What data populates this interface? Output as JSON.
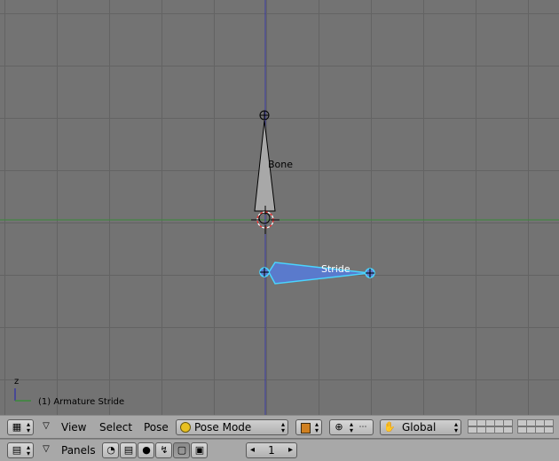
{
  "viewport": {
    "bone1_label": "Bone",
    "bone2_label": "Stride",
    "status_text": "(1) Armature Stride",
    "axis_z": "z"
  },
  "header1": {
    "menus": [
      "View",
      "Select",
      "Pose"
    ],
    "mode_value": "Pose Mode",
    "orientation_value": "Global"
  },
  "header2": {
    "panels_label": "Panels",
    "frame_value": "1"
  },
  "icons": {
    "window_type": "view3d-grid-icon",
    "mode": "pose-mode-smiley-icon",
    "pivot": "pivot-icon",
    "manipulator": "hand-icon",
    "buttons_window": "buttons-window-icon"
  },
  "colors": {
    "viewport_bg": "#737373",
    "grid": "#636363",
    "x_axis": "#3a8a3a",
    "z_axis": "#3a3aa0",
    "bone_gray": "#a8a8a8",
    "bone_selected": "#5a7acc",
    "selected_outline": "#4ad4ff",
    "header_bg": "#a8a8a8"
  }
}
